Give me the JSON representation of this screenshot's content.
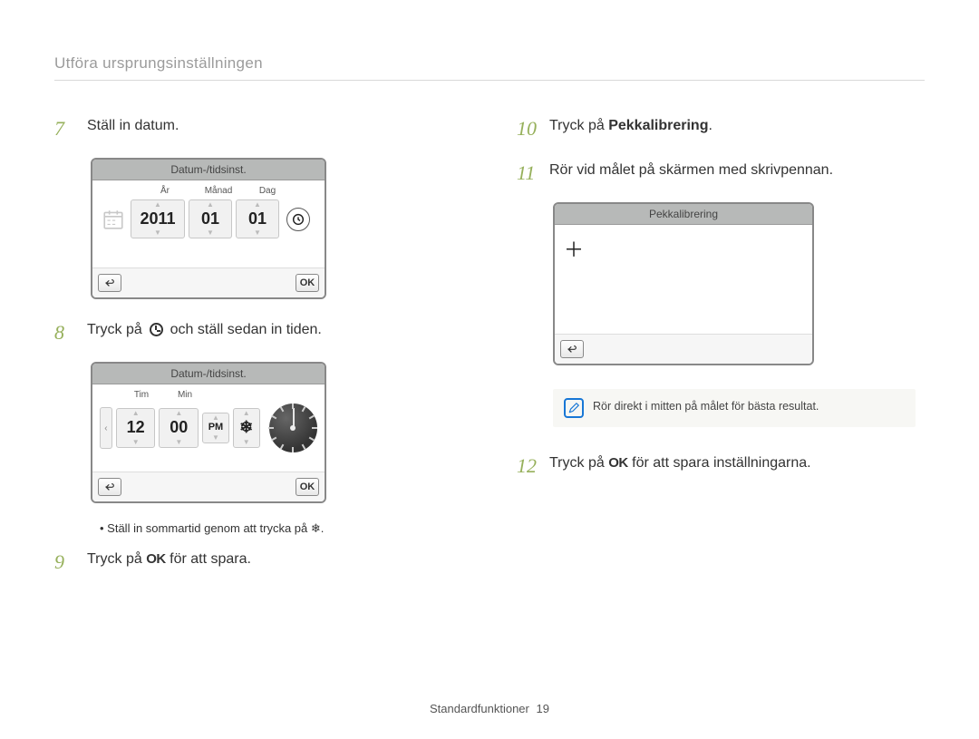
{
  "header": {
    "title": "Utföra ursprungsinställningen"
  },
  "steps": {
    "s7": {
      "num": "7",
      "text": "Ställ in datum."
    },
    "s8": {
      "num": "8",
      "before": "Tryck på ",
      "after": " och ställ sedan in tiden."
    },
    "s9": {
      "num": "9",
      "before": "Tryck på ",
      "ok": "OK",
      "after": " för att spara."
    },
    "s10": {
      "num": "10",
      "before": "Tryck på ",
      "bold": "Pekkalibrering",
      "after": "."
    },
    "s11": {
      "num": "11",
      "text": "Rör vid målet på skärmen med skrivpennan."
    },
    "s12": {
      "num": "12",
      "before": "Tryck på ",
      "ok": "OK",
      "after": " för att spara inställningarna."
    }
  },
  "date_screen": {
    "title": "Datum-/tidsinst.",
    "labels": {
      "year": "År",
      "month": "Månad",
      "day": "Dag"
    },
    "values": {
      "year": "2011",
      "month": "01",
      "day": "01"
    },
    "ok_label": "OK"
  },
  "time_screen": {
    "title": "Datum-/tidsinst.",
    "labels": {
      "hour": "Tim",
      "min": "Min"
    },
    "values": {
      "hour": "12",
      "min": "00",
      "ampm": "PM"
    },
    "ok_label": "OK"
  },
  "dst_note": {
    "text": "Ställ in sommartid genom att trycka på "
  },
  "calibration_screen": {
    "title": "Pekkalibrering"
  },
  "tip": {
    "text": "Rör direkt i mitten på målet för bästa resultat."
  },
  "footer": {
    "section": "Standardfunktioner",
    "page": "19"
  }
}
